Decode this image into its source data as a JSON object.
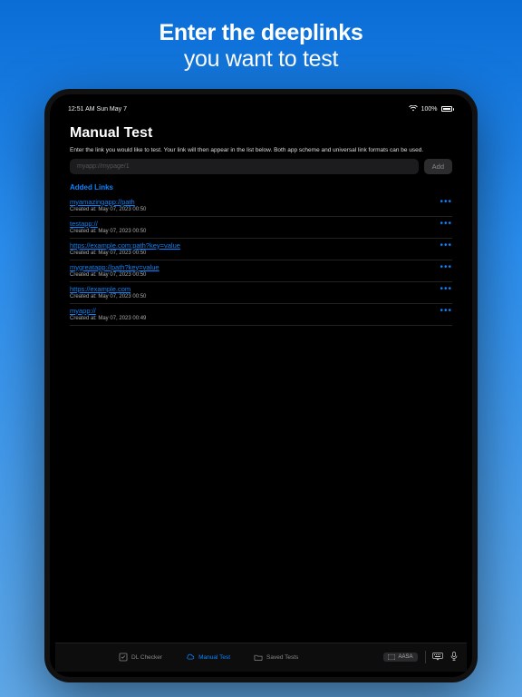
{
  "promo": {
    "line1": "Enter the deeplinks",
    "line2": "you want to test"
  },
  "status": {
    "time_date": "12:51 AM  Sun May 7",
    "battery": "100%"
  },
  "page": {
    "title": "Manual Test",
    "helper": "Enter the link you would like to test. Your link will then appear in the list below. Both app scheme and universal link formats can be used.",
    "input_placeholder": "myapp://mypage/1",
    "add_label": "Add",
    "section_header": "Added Links",
    "links": [
      {
        "url": "myamazingapp://path",
        "meta": "Created at: May 07, 2023 00:50"
      },
      {
        "url": "testapp://",
        "meta": "Created at: May 07, 2023 00:50"
      },
      {
        "url": "https://example.com:path?key=value",
        "meta": "Created at: May 07, 2023 00:50"
      },
      {
        "url": "mygreatapp://path?key=value",
        "meta": "Created at: May 07, 2023 00:50"
      },
      {
        "url": "https://example.com",
        "meta": "Created at: May 07, 2023 00:50"
      },
      {
        "url": "myapp://",
        "meta": "Created at: May 07, 2023 00:49"
      }
    ]
  },
  "tabs": {
    "dl_checker": "DL Checker",
    "manual_test": "Manual Test",
    "saved_tests": "Saved Tests",
    "aasa": "AASA"
  }
}
